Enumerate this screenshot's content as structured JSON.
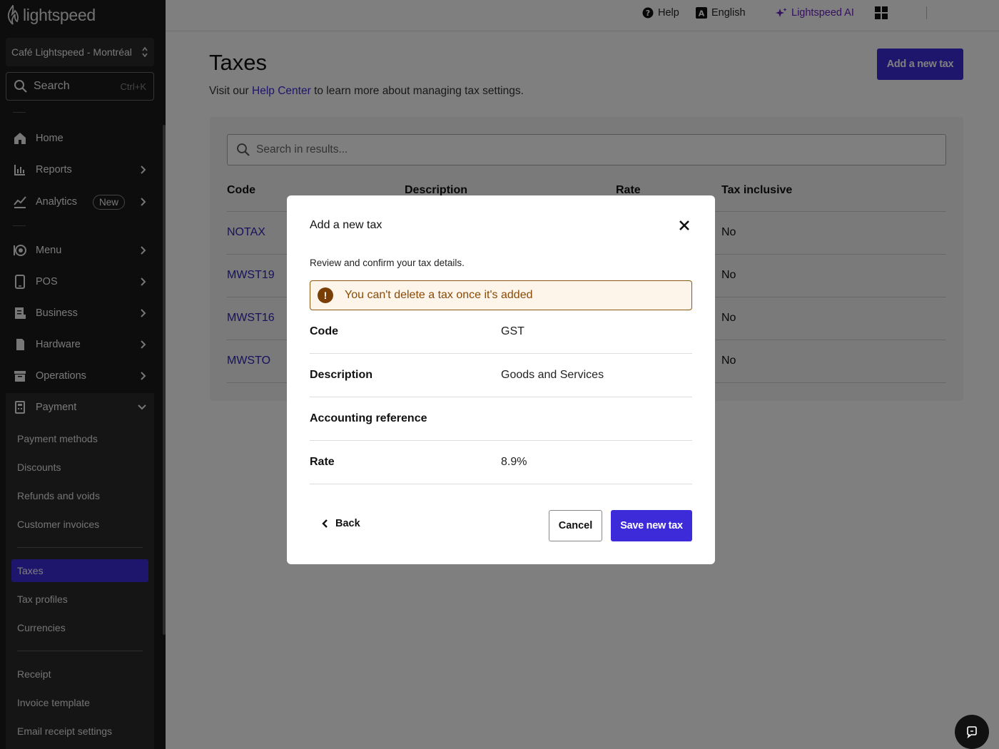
{
  "sidebar": {
    "logo_text": "lightspeed",
    "location": "Café Lightspeed - Montréal",
    "search_label": "Search",
    "search_shortcut": "Ctrl+K",
    "nav": {
      "home": "Home",
      "reports": "Reports",
      "analytics": "Analytics",
      "analytics_badge": "New",
      "menu": "Menu",
      "pos": "POS",
      "business": "Business",
      "hardware": "Hardware",
      "operations": "Operations",
      "payment": "Payment"
    },
    "payment_sub": {
      "payment_methods": "Payment methods",
      "discounts": "Discounts",
      "refunds": "Refunds and voids",
      "customer_invoices": "Customer invoices",
      "taxes": "Taxes",
      "tax_profiles": "Tax profiles",
      "currencies": "Currencies",
      "receipt": "Receipt",
      "invoice_template": "Invoice template",
      "email_receipt": "Email receipt settings"
    }
  },
  "topbar": {
    "help": "Help",
    "language": "English",
    "ai": "Lightspeed AI"
  },
  "main": {
    "title": "Taxes",
    "subtitle_prefix": "Visit our",
    "subtitle_link": "Help Center",
    "subtitle_suffix": "to learn more about managing tax settings.",
    "add_button": "Add a new tax",
    "search_placeholder": "Search in results...",
    "columns": {
      "code": "Code",
      "description": "Description",
      "rate": "Rate",
      "inclusive": "Tax inclusive"
    },
    "rows": [
      {
        "code": "NOTAX",
        "inclusive": "No"
      },
      {
        "code": "MWST19",
        "inclusive": "No"
      },
      {
        "code": "MWST16",
        "inclusive": "No"
      },
      {
        "code": "MWSTO",
        "inclusive": "No"
      }
    ]
  },
  "modal": {
    "title": "Add a new tax",
    "subtitle": "Review and confirm your tax details.",
    "warning": "You can't delete a tax once it's added",
    "fields": {
      "code_label": "Code",
      "code_value": "GST",
      "description_label": "Description",
      "description_value": "Goods and Services",
      "accounting_label": "Accounting reference",
      "accounting_value": "",
      "rate_label": "Rate",
      "rate_value": "8.9%"
    },
    "back": "Back",
    "cancel": "Cancel",
    "save": "Save new tax"
  },
  "colors": {
    "primary": "#3d2ad8",
    "sidebar_bg": "#1a1a1a",
    "warning_text": "#8a4a06",
    "warning_bg": "#fdf5ea",
    "ai_accent": "#6b1fc0"
  }
}
